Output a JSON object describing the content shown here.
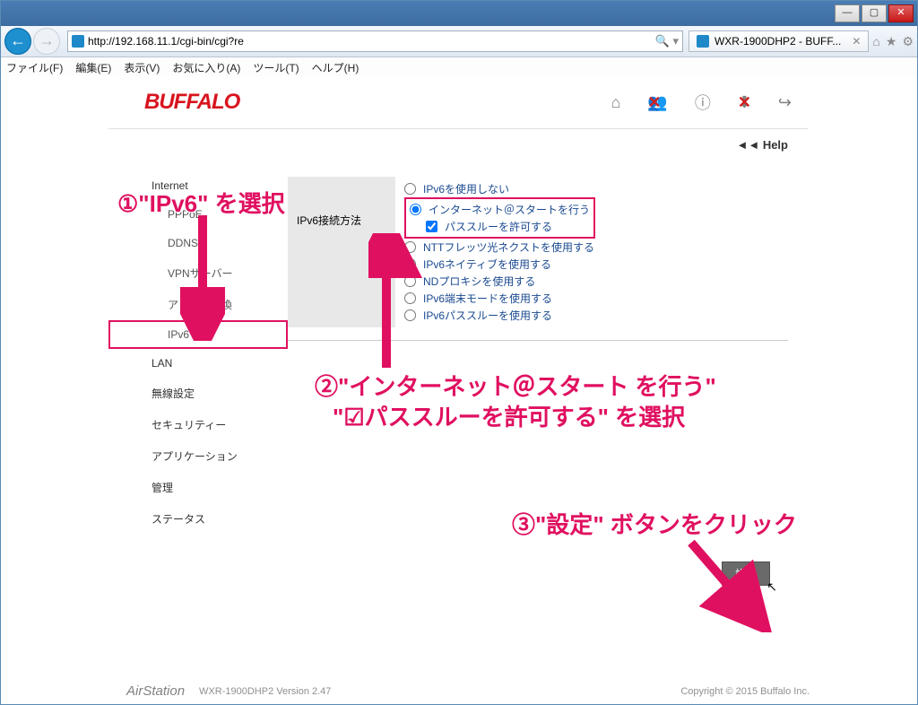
{
  "window": {
    "url": "http://192.168.11.1/cgi-bin/cgi?re",
    "tab_title": "WXR-1900DHP2 - BUFF...",
    "btn_min": "—",
    "btn_max": "▢",
    "btn_close": "✕"
  },
  "menubar": [
    "ファイル(F)",
    "編集(E)",
    "表示(V)",
    "お気に入り(A)",
    "ツール(T)",
    "ヘルプ(H)"
  ],
  "header": {
    "logo": "BUFFALO",
    "help": "◄◄ Help"
  },
  "sidebar": {
    "items": [
      {
        "label": "Internet",
        "sub": false
      },
      {
        "label": "PPPoE",
        "sub": true
      },
      {
        "label": "DDNS",
        "sub": true
      },
      {
        "label": "VPNサーバー",
        "sub": true
      },
      {
        "label": "アドレス変換",
        "sub": true
      },
      {
        "label": "IPv6",
        "sub": true,
        "selected": true
      },
      {
        "label": "LAN",
        "sub": false
      },
      {
        "label": "無線設定",
        "sub": false
      },
      {
        "label": "セキュリティー",
        "sub": false
      },
      {
        "label": "アプリケーション",
        "sub": false
      },
      {
        "label": "管理",
        "sub": false
      },
      {
        "label": "ステータス",
        "sub": false
      }
    ]
  },
  "ipv6": {
    "section_label": "IPv6接続方法",
    "options": [
      {
        "kind": "radio",
        "label": "IPv6を使用しない",
        "checked": false
      },
      {
        "kind": "radio",
        "label": "インターネット＠スタートを行う",
        "checked": true
      },
      {
        "kind": "checkbox",
        "label": "パススルーを許可する",
        "checked": true,
        "indent": true
      },
      {
        "kind": "radio",
        "label": "NTTフレッツ光ネクストを使用する",
        "checked": false
      },
      {
        "kind": "radio",
        "label": "IPv6ネイティブを使用する",
        "checked": false
      },
      {
        "kind": "radio",
        "label": "NDプロキシを使用する",
        "checked": false
      },
      {
        "kind": "radio",
        "label": "IPv6端末モードを使用する",
        "checked": false
      },
      {
        "kind": "radio",
        "label": "IPv6パススルーを使用する",
        "checked": false
      }
    ],
    "apply": "設定"
  },
  "footer": {
    "brand": "AirStation",
    "model": "WXR-1900DHP2   Version 2.47",
    "copyright": "Copyright © 2015 Buffalo Inc."
  },
  "annotations": {
    "a1": "①\"IPv6\" を選択",
    "a2_line1": "②\"インターネット＠スタート を行う\"",
    "a2_line2": "\"☑パススルーを許可する\"  を選択",
    "a3": "③\"設定\" ボタンをクリック"
  }
}
